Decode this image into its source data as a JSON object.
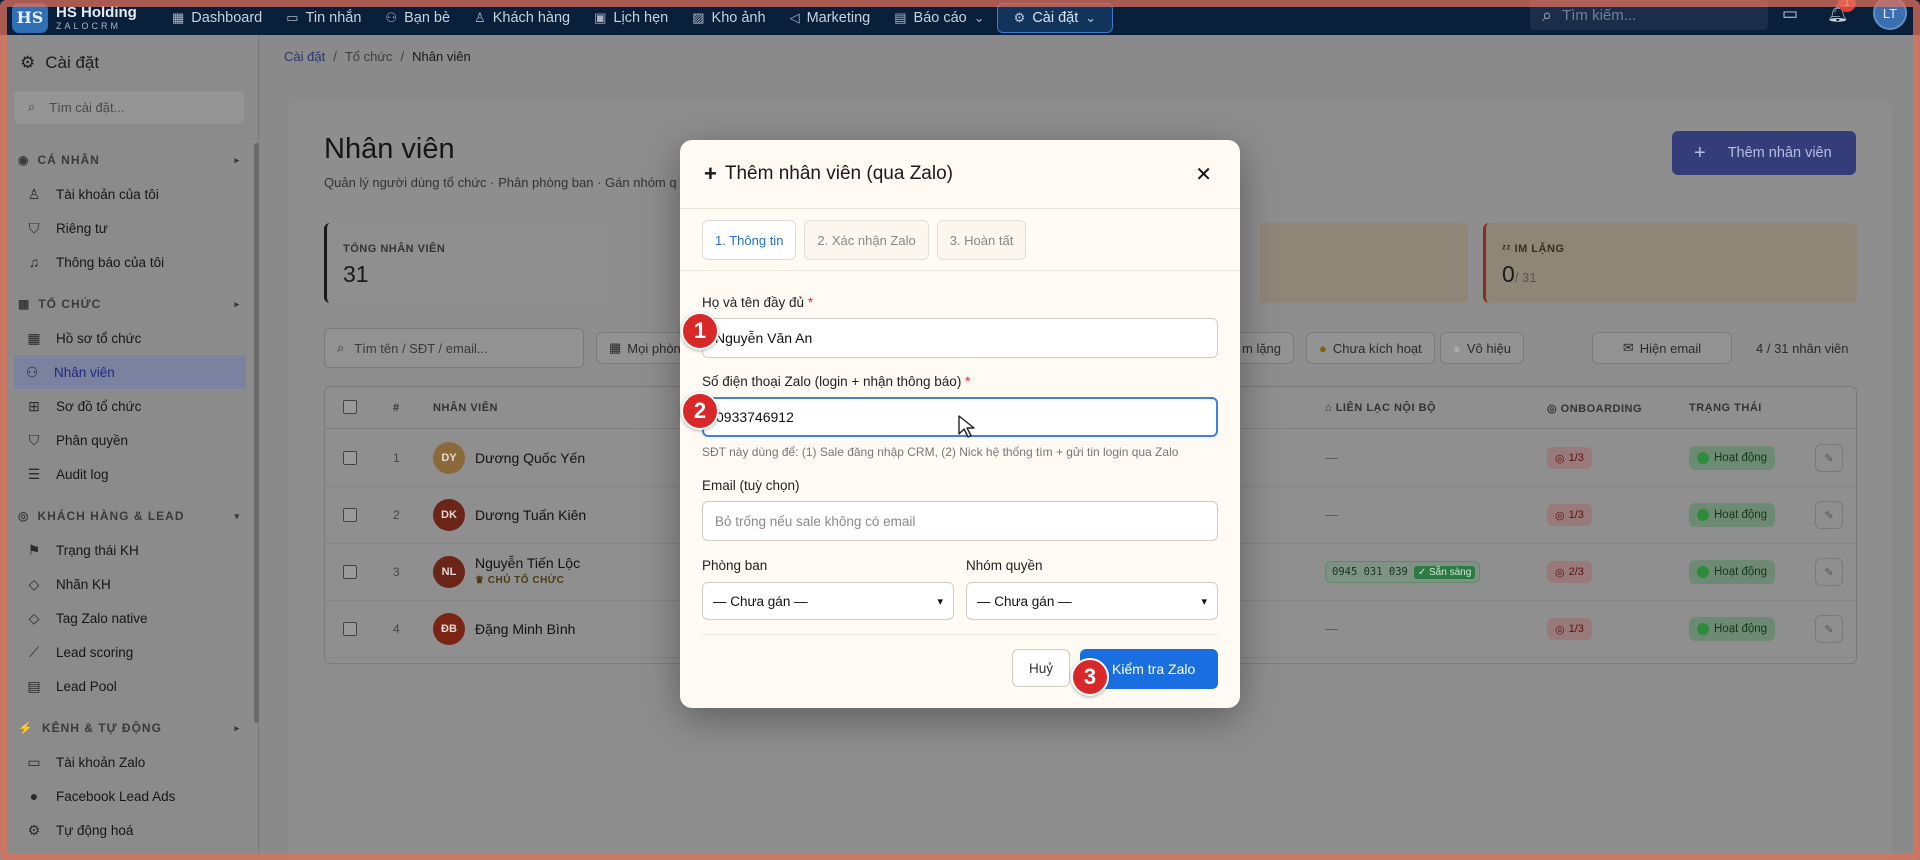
{
  "brand": {
    "logo": "HS",
    "name": "HS Holding",
    "sub": "ZALOCRM"
  },
  "nav": [
    {
      "label": "Dashboard",
      "icon": "grid-icon"
    },
    {
      "label": "Tin nhắn",
      "icon": "chat-icon"
    },
    {
      "label": "Bạn bè",
      "icon": "users-icon"
    },
    {
      "label": "Khách hàng",
      "icon": "user-icon"
    },
    {
      "label": "Lịch hẹn",
      "icon": "calendar-icon"
    },
    {
      "label": "Kho ảnh",
      "icon": "image-icon"
    },
    {
      "label": "Marketing",
      "icon": "megaphone-icon"
    },
    {
      "label": "Báo cáo",
      "icon": "report-icon"
    },
    {
      "label": "Cài đặt",
      "icon": "gear-icon"
    }
  ],
  "search": {
    "placeholder": "Tìm kiếm..."
  },
  "notifications": {
    "count": "1"
  },
  "user": {
    "initials": "LT"
  },
  "sidebar": {
    "title": "Cài đặt",
    "search_placeholder": "Tìm cài đặt...",
    "sections": [
      {
        "label": "CÁ NHÂN",
        "items": [
          "Tài khoản của tôi",
          "Riêng tư",
          "Thông báo của tôi"
        ]
      },
      {
        "label": "TỔ CHỨC",
        "items": [
          "Hồ sơ tổ chức",
          "Nhân viên",
          "Sơ đồ tổ chức",
          "Phân quyền",
          "Audit log"
        ]
      },
      {
        "label": "KHÁCH HÀNG & LEAD",
        "items": [
          "Trạng thái KH",
          "Nhãn KH",
          "Tag Zalo native",
          "Lead scoring",
          "Lead Pool"
        ]
      },
      {
        "label": "KÊNH & TỰ ĐỘNG",
        "items": [
          "Tài khoản Zalo",
          "Facebook Lead Ads",
          "Tự động hoá"
        ]
      }
    ]
  },
  "breadcrumb": {
    "a": "Cài đặt",
    "b": "Tổ chức",
    "c": "Nhân viên",
    "sep": "/"
  },
  "page": {
    "title": "Nhân viên",
    "subtitle": "Quản lý người dùng tổ chức · Phân phòng ban · Gán nhóm q",
    "add_button": "Thêm nhân viên"
  },
  "stats": {
    "total_label": "TỔNG NHÂN VIÊN",
    "total_value": "31",
    "silent_label": "IM LẶNG",
    "silent_value": "0",
    "silent_of": "/ 31"
  },
  "filters": {
    "search_placeholder": "Tìm tên / SĐT / email...",
    "all_depts": "Mọi phòn",
    "silent": "m lặng",
    "inactive": "Chưa kích hoạt",
    "disabled": "Vô hiệu",
    "show_email": "Hiện email",
    "count": "4 / 31 nhân viên"
  },
  "table": {
    "headers": {
      "num": "#",
      "staff": "NHÂN VIÊN",
      "contact": "LIÊN LẠC NỘI BỘ",
      "onboarding": "ONBOARDING",
      "status": "TRẠNG THÁI"
    },
    "rows": [
      {
        "num": "1",
        "initials": "DY",
        "name": "Dương Quốc Yến",
        "role": "",
        "contact": "—",
        "onboarding": "1/3",
        "status": "Hoạt động",
        "avatar_color": "#8a6a3a"
      },
      {
        "num": "2",
        "initials": "DK",
        "name": "Dương Tuấn Kiên",
        "role": "",
        "contact": "—",
        "onboarding": "1/3",
        "status": "Hoạt động",
        "avatar_color": "#6a2418"
      },
      {
        "num": "3",
        "initials": "NL",
        "name": "Nguyễn Tiến Lộc",
        "role": "CHỦ TỔ CHỨC",
        "contact": "0945 031 039",
        "contact_badge": "✓ Sẵn sàng",
        "onboarding": "2/3",
        "status": "Hoạt động",
        "avatar_color": "#6a2418"
      },
      {
        "num": "4",
        "initials": "ĐB",
        "name": "Đặng Minh Bình",
        "role": "",
        "contact": "—",
        "onboarding": "1/3",
        "status": "Hoạt động",
        "avatar_color": "#7a2416"
      }
    ]
  },
  "modal": {
    "title": "Thêm nhân viên (qua Zalo)",
    "steps": [
      "1. Thông tin",
      "2. Xác nhận Zalo",
      "3. Hoàn tất"
    ],
    "name_label": "Họ và tên đầy đủ",
    "name_value": "Nguyễn Văn An",
    "phone_label": "Số điện thoại Zalo (login + nhận thông báo)",
    "phone_value": "0933746912",
    "phone_hint": "SĐT này dùng để: (1) Sale đăng nhập CRM, (2) Nick hệ thống tìm + gửi tin login qua Zalo",
    "email_label": "Email (tuỳ chọn)",
    "email_placeholder": "Bỏ trống nếu sale không có email",
    "dept_label": "Phòng ban",
    "dept_value": "— Chưa gán —",
    "role_label": "Nhóm quyền",
    "role_value": "— Chưa gán —",
    "cancel": "Huỷ",
    "submit": "Kiểm tra Zalo",
    "required_mark": "*"
  },
  "markers": [
    "1",
    "2",
    "3"
  ],
  "colors": {
    "accent": "#1a6fe0",
    "nav_bg": "#0a1f3a",
    "marker": "#d8282a",
    "modal_bg": "#fffaf3"
  }
}
